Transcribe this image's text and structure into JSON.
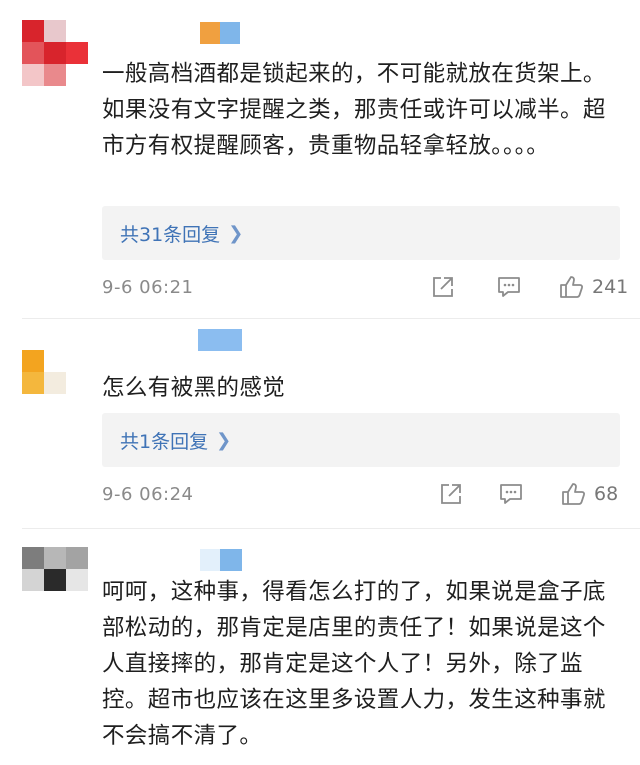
{
  "comments": [
    {
      "text": "一般高档酒都是锁起来的，不可能就放在货架上。如果没有文字提醒之类，那责任或许可以减半。超市方有权提醒顾客，贵重物品轻拿轻放。。。。",
      "reply_label": "共31条回复",
      "time": "9-6 06:21",
      "likes": "241"
    },
    {
      "text": "怎么有被黑的感觉",
      "reply_label": "共1条回复",
      "time": "9-6 06:24",
      "likes": "68"
    },
    {
      "text": "呵呵，这种事，得看怎么打的了，如果说是盒子底部松动的，那肯定是店里的责任了！如果说是这个人直接摔的，那肯定是这个人了！另外，除了监控。超市也应该在这里多设置人力，发生这种事就不会搞不清了。"
    }
  ],
  "colors": {
    "link": "#3f73b6",
    "meta": "#8a8a8a",
    "reply_bg": "#f3f3f3"
  },
  "icons": {
    "share": "share-icon",
    "comment": "comment-icon",
    "like": "thumbs-up-icon",
    "chevron": "chevron-right-icon"
  }
}
